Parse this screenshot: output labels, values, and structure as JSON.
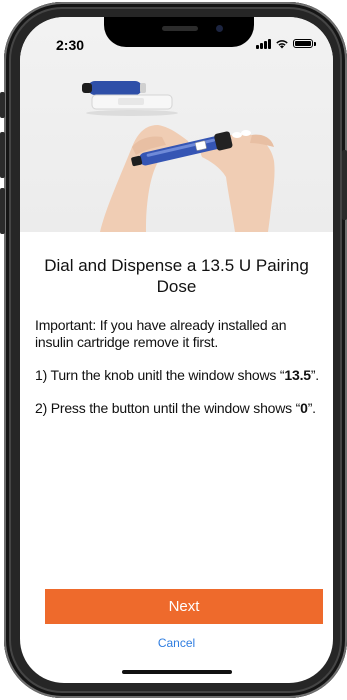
{
  "status_bar": {
    "time": "2:30",
    "icons": [
      "signal-icon",
      "wifi-icon",
      "battery-icon"
    ]
  },
  "hero_image": {
    "subject": "insulin-pen-photo"
  },
  "step": {
    "title": "Dial and Dispense a 13.5 U Pairing Dose",
    "important": "Important: If you have already installed an insulin cartridge remove it first.",
    "step1_prefix": "1) Turn the knob unitl the window shows “",
    "step1_value": "13.5",
    "step1_suffix": "”.",
    "step2_prefix": "2) Press the button until the window shows “",
    "step2_value": "0",
    "step2_suffix": "”."
  },
  "actions": {
    "next_label": "Next",
    "cancel_label": "Cancel"
  },
  "colors": {
    "primary_button": "#ee6a2c",
    "link": "#2f7de0"
  }
}
